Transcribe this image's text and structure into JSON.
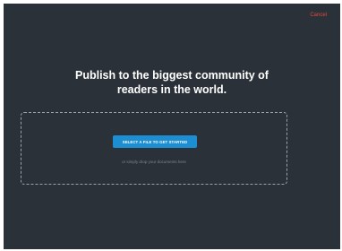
{
  "header": {
    "cancel_label": "Cancel"
  },
  "main": {
    "headline": "Publish to the biggest community of readers in the world."
  },
  "dropzone": {
    "select_button_label": "SELECT A FILE TO GET STARTED",
    "hint": "or simply drop your documents here"
  },
  "colors": {
    "background": "#2b3138",
    "accent": "#1d8ed1",
    "cancel": "#e24b3a"
  }
}
